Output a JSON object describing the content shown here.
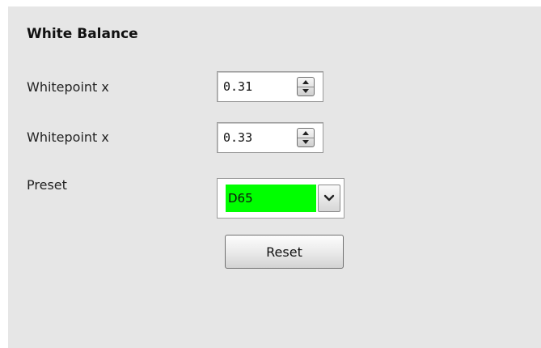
{
  "panel": {
    "title": "White Balance"
  },
  "rows": [
    {
      "label": "Whitepoint x",
      "value": "0.31"
    },
    {
      "label": "Whitepoint x",
      "value": "0.33"
    }
  ],
  "preset": {
    "label": "Preset",
    "value": "D65",
    "highlight_color": "#00ff00"
  },
  "reset_button": {
    "label": "Reset"
  }
}
